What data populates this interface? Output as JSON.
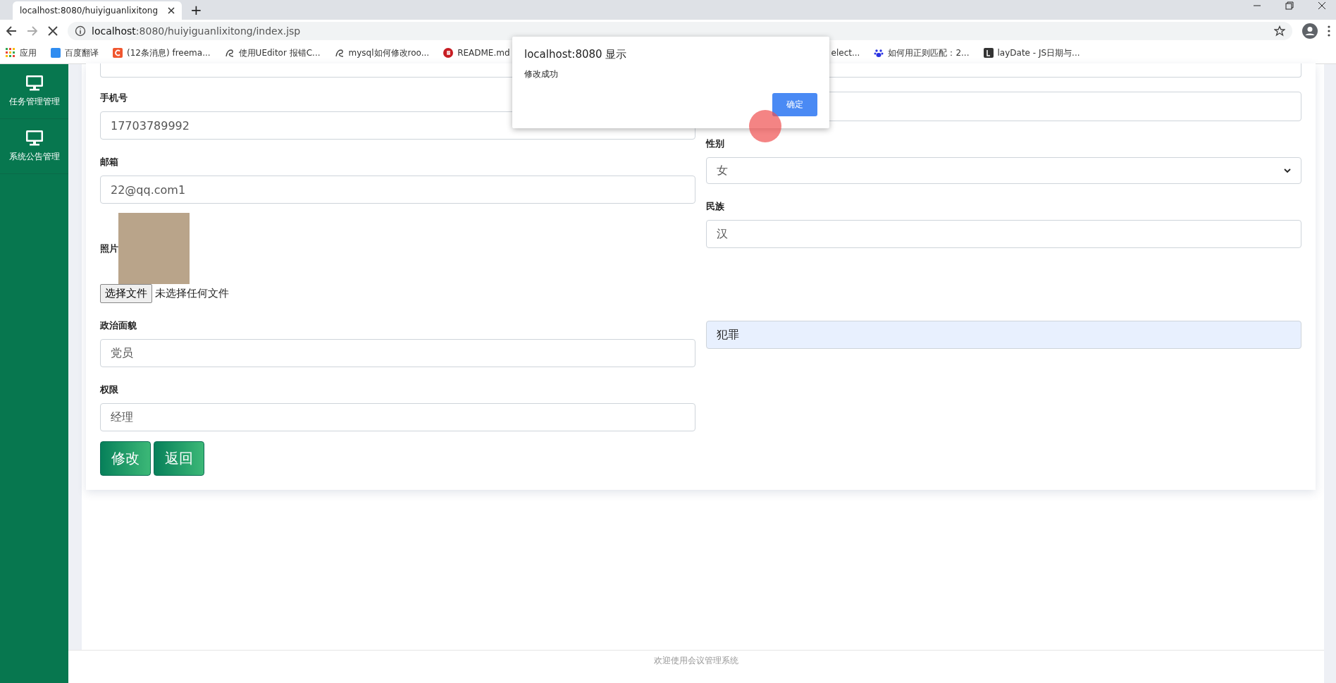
{
  "browser": {
    "tab_title": "localhost:8080/huiyiguanlixitong",
    "new_tab": "+",
    "url_host": "localhost",
    "url_rest": ":8080/huiyiguanlixitong/index.jsp",
    "bookmarks": [
      {
        "label": "应用",
        "kind": "apps"
      },
      {
        "label": "百度翻译",
        "kind": "translate"
      },
      {
        "label": "(12条消息) freema...",
        "kind": "csdn"
      },
      {
        "label": "使用UEditor 报错C...",
        "kind": "swirl"
      },
      {
        "label": "mysql如何修改roo...",
        "kind": "swirl"
      },
      {
        "label": "README.md",
        "kind": "gitee"
      },
      {
        "label": "elect...",
        "kind": "none"
      },
      {
        "label": "如何用正则匹配：2...",
        "kind": "baidu"
      },
      {
        "label": "layDate - JS日期与...",
        "kind": "laydate"
      }
    ]
  },
  "sidebar": {
    "items": [
      {
        "label": "任务管理管理"
      },
      {
        "label": "系统公告管理"
      }
    ]
  },
  "form": {
    "left": [
      {
        "kind": "input",
        "label": "手机号",
        "value": "17703789992"
      },
      {
        "kind": "input",
        "label": "邮箱",
        "value": "22@qq.com1"
      },
      {
        "kind": "photo",
        "label": "照片",
        "file_button": "选择文件",
        "file_status": "未选择任何文件"
      },
      {
        "kind": "input",
        "label": "政治面貌",
        "value": "党员"
      },
      {
        "kind": "input",
        "label": "权限",
        "value": "经理"
      }
    ],
    "right": [
      {
        "kind": "input"
      },
      {
        "kind": "select",
        "label": "性别",
        "value": "女"
      },
      {
        "kind": "input",
        "label": "民族",
        "value": "汉"
      },
      {
        "kind": "autofill",
        "value": "犯罪"
      }
    ],
    "buttons": [
      "修改",
      "返回"
    ]
  },
  "dialog": {
    "title": "localhost:8080 显示",
    "message": "修改成功",
    "button": "确定"
  },
  "footer": {
    "text": "欢迎使用会议管理系统"
  }
}
